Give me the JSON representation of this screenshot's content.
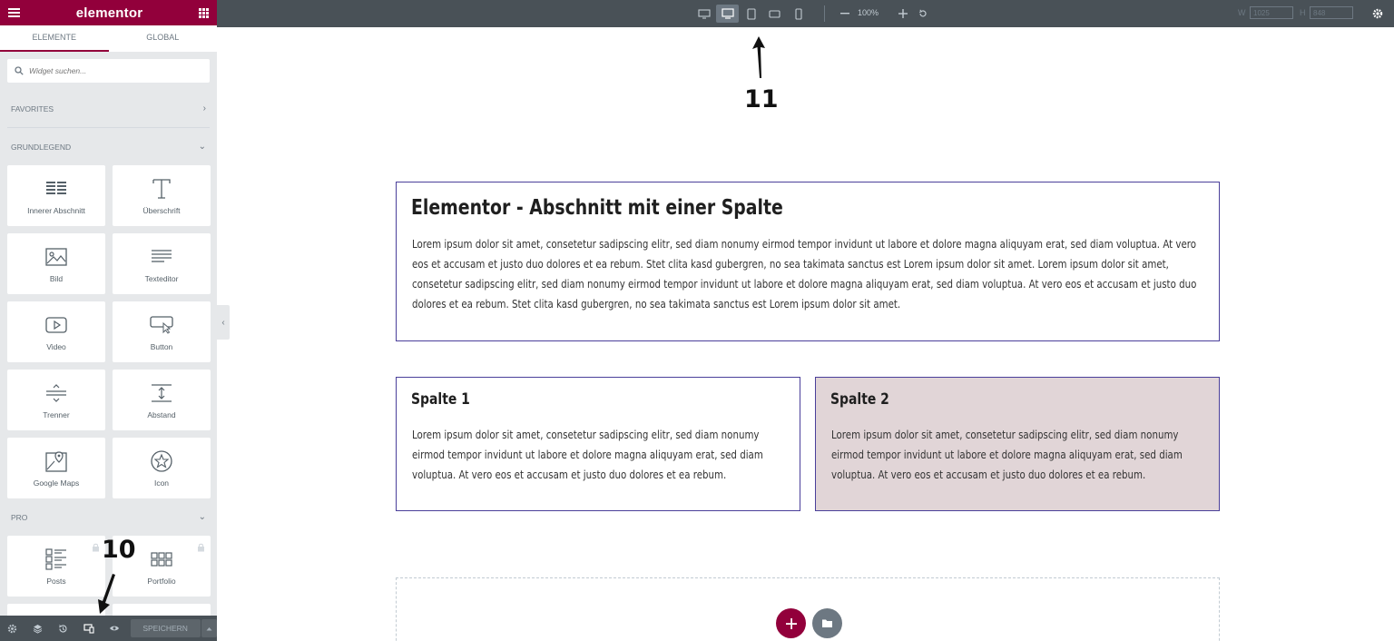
{
  "app": {
    "logo": "elementor"
  },
  "panel": {
    "tabs": [
      {
        "label": "ELEMENTE",
        "active": true
      },
      {
        "label": "GLOBAL",
        "active": false
      }
    ],
    "search": {
      "placeholder": "Widget suchen..."
    },
    "categories": {
      "favorites": {
        "label": "FAVORITES"
      },
      "basic": {
        "label": "GRUNDLEGEND",
        "widgets": [
          {
            "label": "Innerer Abschnitt",
            "icon": "inner-section-icon"
          },
          {
            "label": "Überschrift",
            "icon": "heading-icon"
          },
          {
            "label": "Bild",
            "icon": "image-icon"
          },
          {
            "label": "Texteditor",
            "icon": "text-editor-icon"
          },
          {
            "label": "Video",
            "icon": "video-icon"
          },
          {
            "label": "Button",
            "icon": "button-icon"
          },
          {
            "label": "Trenner",
            "icon": "divider-icon"
          },
          {
            "label": "Abstand",
            "icon": "spacer-icon"
          },
          {
            "label": "Google Maps",
            "icon": "google-maps-icon"
          },
          {
            "label": "Icon",
            "icon": "star-icon"
          }
        ]
      },
      "pro": {
        "label": "PRO",
        "widgets": [
          {
            "label": "Posts",
            "icon": "posts-icon",
            "locked": true
          },
          {
            "label": "Portfolio",
            "icon": "portfolio-icon",
            "locked": true
          }
        ]
      }
    },
    "footer": {
      "save_label": "SPEICHERN"
    }
  },
  "topbar": {
    "zoom": "100%",
    "width_label": "W",
    "width_value": "1025",
    "height_label": "H",
    "height_value": "848"
  },
  "canvas": {
    "section1": {
      "title": "Elementor - Abschnitt mit einer Spalte",
      "text": "Lorem ipsum dolor sit amet, consetetur sadipscing elitr, sed diam nonumy eirmod tempor invidunt ut labore et dolore magna aliquyam erat, sed diam voluptua. At vero eos et accusam et justo duo dolores et ea rebum. Stet clita kasd gubergren, no sea takimata sanctus est Lorem ipsum dolor sit amet. Lorem ipsum dolor sit amet, consetetur sadipscing elitr, sed diam nonumy eirmod tempor invidunt ut labore et dolore magna aliquyam erat, sed diam voluptua. At vero eos et accusam et justo duo dolores et ea rebum. Stet clita kasd gubergren, no sea takimata sanctus est Lorem ipsum dolor sit amet."
    },
    "column1": {
      "title": "Spalte 1",
      "text": "Lorem ipsum dolor sit amet, consetetur sadipscing elitr, sed diam nonumy eirmod tempor invidunt ut labore et dolore magna aliquyam erat, sed diam voluptua. At vero eos et accusam et justo duo dolores et ea rebum."
    },
    "column2": {
      "title": "Spalte 2",
      "text": "Lorem ipsum dolor sit amet, consetetur sadipscing elitr, sed diam nonumy eirmod tempor invidunt ut labore et dolore magna aliquyam erat, sed diam voluptua. At vero eos et accusam et justo duo dolores et ea rebum."
    }
  },
  "annotations": {
    "top": "11",
    "bottom": "10"
  },
  "colors": {
    "brand": "#92003b",
    "toolbar": "#495157",
    "panel": "#e6e8ea",
    "column2_bg": "#e1d5d7",
    "section_border": "#4a3f9a"
  }
}
